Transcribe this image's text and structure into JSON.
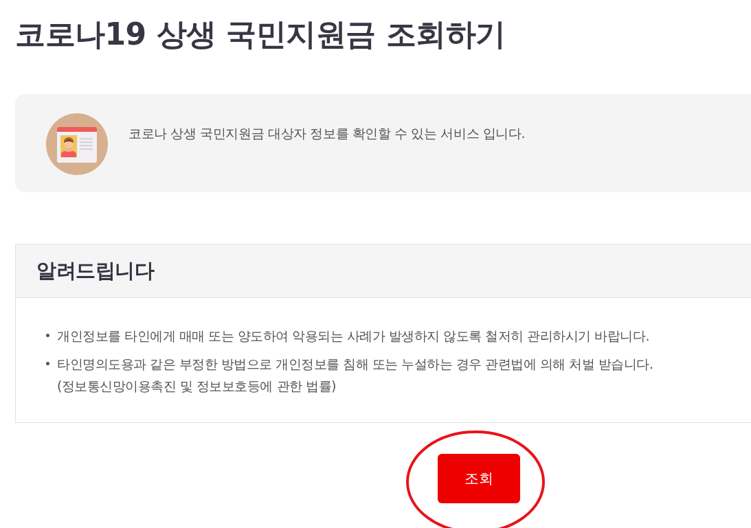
{
  "page": {
    "title": "코로나19 상생 국민지원금 조회하기"
  },
  "info_card": {
    "text": "코로나 상생 국민지원금 대상자 정보를 확인할 수 있는 서비스 입니다."
  },
  "notice": {
    "title": "알려드립니다",
    "items": [
      {
        "text": "개인정보를 타인에게 매매 또는 양도하여 악용되는 사례가 발생하지 않도록 철저히 관리하시기 바랍니다."
      },
      {
        "text": "타인명의도용과 같은 부정한 방법으로 개인정보를 침해 또는 누설하는 경우 관련법에 의해 처벌 받습니다.",
        "note": "(정보통신망이용촉진 및 정보보호등에 관한 법률)"
      }
    ]
  },
  "button": {
    "label": "조회",
    "highlighted": true
  }
}
